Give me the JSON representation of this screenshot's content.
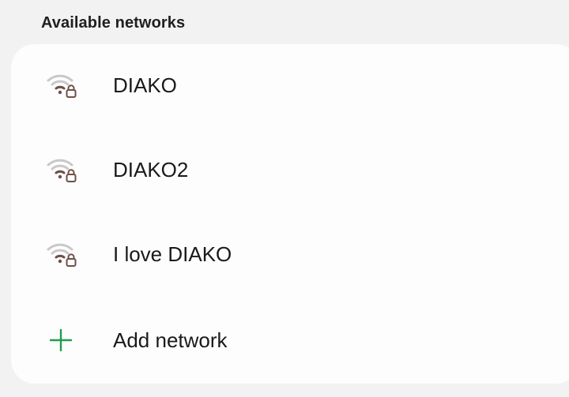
{
  "section": {
    "title": "Available networks"
  },
  "networks": [
    {
      "name": "DIAKO",
      "icon": "wifi-lock-icon",
      "secured": true
    },
    {
      "name": "DIAKO2",
      "icon": "wifi-lock-icon",
      "secured": true
    },
    {
      "name": "I love DIAKO",
      "icon": "wifi-lock-icon",
      "secured": true
    }
  ],
  "add_network": {
    "label": "Add network",
    "icon": "plus-icon"
  },
  "colors": {
    "background": "#f2f2f2",
    "card": "#fdfdfd",
    "wifi_bars_dim": "#c9c9c9",
    "wifi_bars_active": "#6e4f47",
    "lock": "#6e4f47",
    "plus": "#1e9e4a",
    "text": "#1a1a1a"
  }
}
